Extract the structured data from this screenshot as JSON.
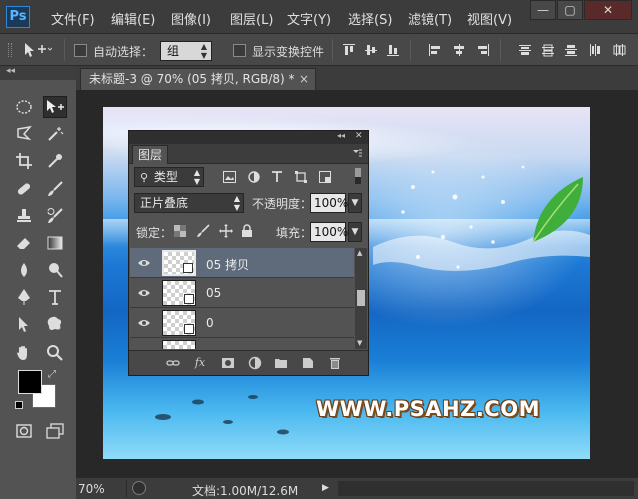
{
  "app": {
    "logo": "Ps"
  },
  "menu": {
    "items": [
      "文件(F)",
      "编辑(E)",
      "图像(I)",
      "图层(L)",
      "文字(Y)",
      "选择(S)",
      "滤镜(T)",
      "视图(V)"
    ]
  },
  "window_controls": {
    "minimize": "—",
    "restore": "▢",
    "close": "✕"
  },
  "options_bar": {
    "auto_select_label": "自动选择：",
    "auto_select_value": "组",
    "show_transform_label": "显示变换控件"
  },
  "document": {
    "tab_title": "未标题-3 @ 70% (05 拷贝, RGB/8) *",
    "tab_close": "×",
    "watermark": "WWW.PSAHZ.COM"
  },
  "layers_panel": {
    "tab_label": "图层",
    "collapse_glyph": "◂◂",
    "close_glyph": "✕",
    "filter_kind": "类型",
    "blend_mode": "正片叠底",
    "opacity_label": "不透明度：",
    "opacity_value": "100%",
    "lock_label": "锁定：",
    "fill_label": "填充：",
    "fill_value": "100%",
    "layers": [
      {
        "name": "05 拷贝",
        "visible": true,
        "selected": true
      },
      {
        "name": "05",
        "visible": true,
        "selected": false
      },
      {
        "name": "0",
        "visible": true,
        "selected": false
      }
    ],
    "footer_icons": [
      "link-icon",
      "fx-icon",
      "mask-icon",
      "adjustment-icon",
      "folder-icon",
      "new-layer-icon",
      "trash-icon"
    ]
  },
  "status_bar": {
    "zoom": "70%",
    "doc_size": "文档:1.00M/12.6M"
  },
  "colors": {
    "foreground": "#000000",
    "background": "#ffffff",
    "selected_layer": "#5f6a7a"
  }
}
